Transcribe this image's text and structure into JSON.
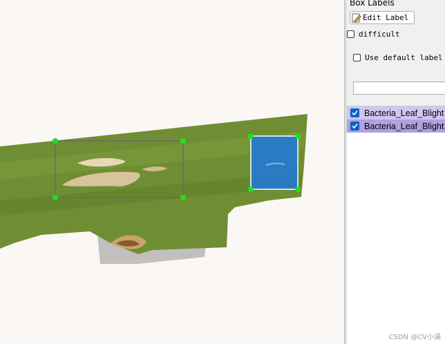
{
  "panel": {
    "title": "Box Labels",
    "edit_label": "Edit Label",
    "difficult_label": "difficult",
    "use_default_label": "Use default label",
    "default_label_value": ""
  },
  "labels": [
    {
      "text": "Bacteria_Leaf_Blight",
      "checked": true,
      "color": "#cfc7f0"
    },
    {
      "text": "Bacteria_Leaf_Blight",
      "checked": true,
      "color": "#b3a0e0"
    }
  ],
  "annotations": [
    {
      "label": "Bacteria_Leaf_Blight",
      "selected": false
    },
    {
      "label": "Bacteria_Leaf_Blight",
      "selected": true,
      "fill_color": "#1e78dc"
    }
  ],
  "icons": {
    "edit": "pencil-icon",
    "check": "checkmark-icon"
  },
  "watermark": "CSDN @CV小涵"
}
